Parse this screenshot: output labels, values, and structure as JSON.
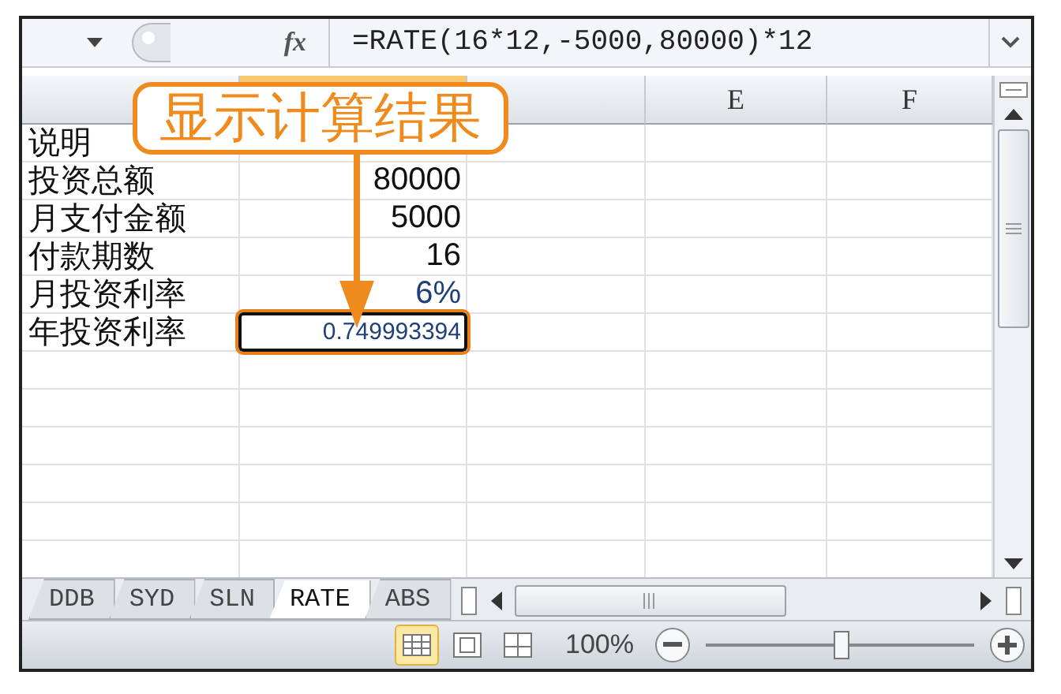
{
  "formula_bar": {
    "function_symbol": "fx",
    "formula": "=RATE(16*12,-5000,80000)*12"
  },
  "column_headers": [
    {
      "selected": false
    },
    {
      "selected": true
    },
    {
      "selected": false
    },
    {
      "label": "E",
      "selected": false
    },
    {
      "label": "F",
      "selected": false
    }
  ],
  "rows": [
    {
      "label": "说明"
    },
    {
      "label": "投资总额",
      "value": "80000"
    },
    {
      "label": "月支付金额",
      "value": "5000"
    },
    {
      "label": "付款期数",
      "value": "16"
    },
    {
      "label": "月投资利率",
      "value": "6%",
      "kind": "percent"
    },
    {
      "label": "年投资利率",
      "value": "0.749993394",
      "kind": "result",
      "active": true
    }
  ],
  "callout": {
    "text": "显示计算结果"
  },
  "sheet_tabs": [
    {
      "label": "DDB",
      "selected": false
    },
    {
      "label": "SYD",
      "selected": false
    },
    {
      "label": "SLN",
      "selected": false
    },
    {
      "label": "RATE",
      "selected": true
    },
    {
      "label": "ABS",
      "selected": false
    }
  ],
  "status_bar": {
    "views": [
      {
        "kind": "normal",
        "selected": true
      },
      {
        "kind": "page-layout",
        "selected": false
      },
      {
        "kind": "page-break",
        "selected": false
      }
    ],
    "zoom": "100%",
    "zoom_slider": {
      "level": 0.5
    }
  }
}
